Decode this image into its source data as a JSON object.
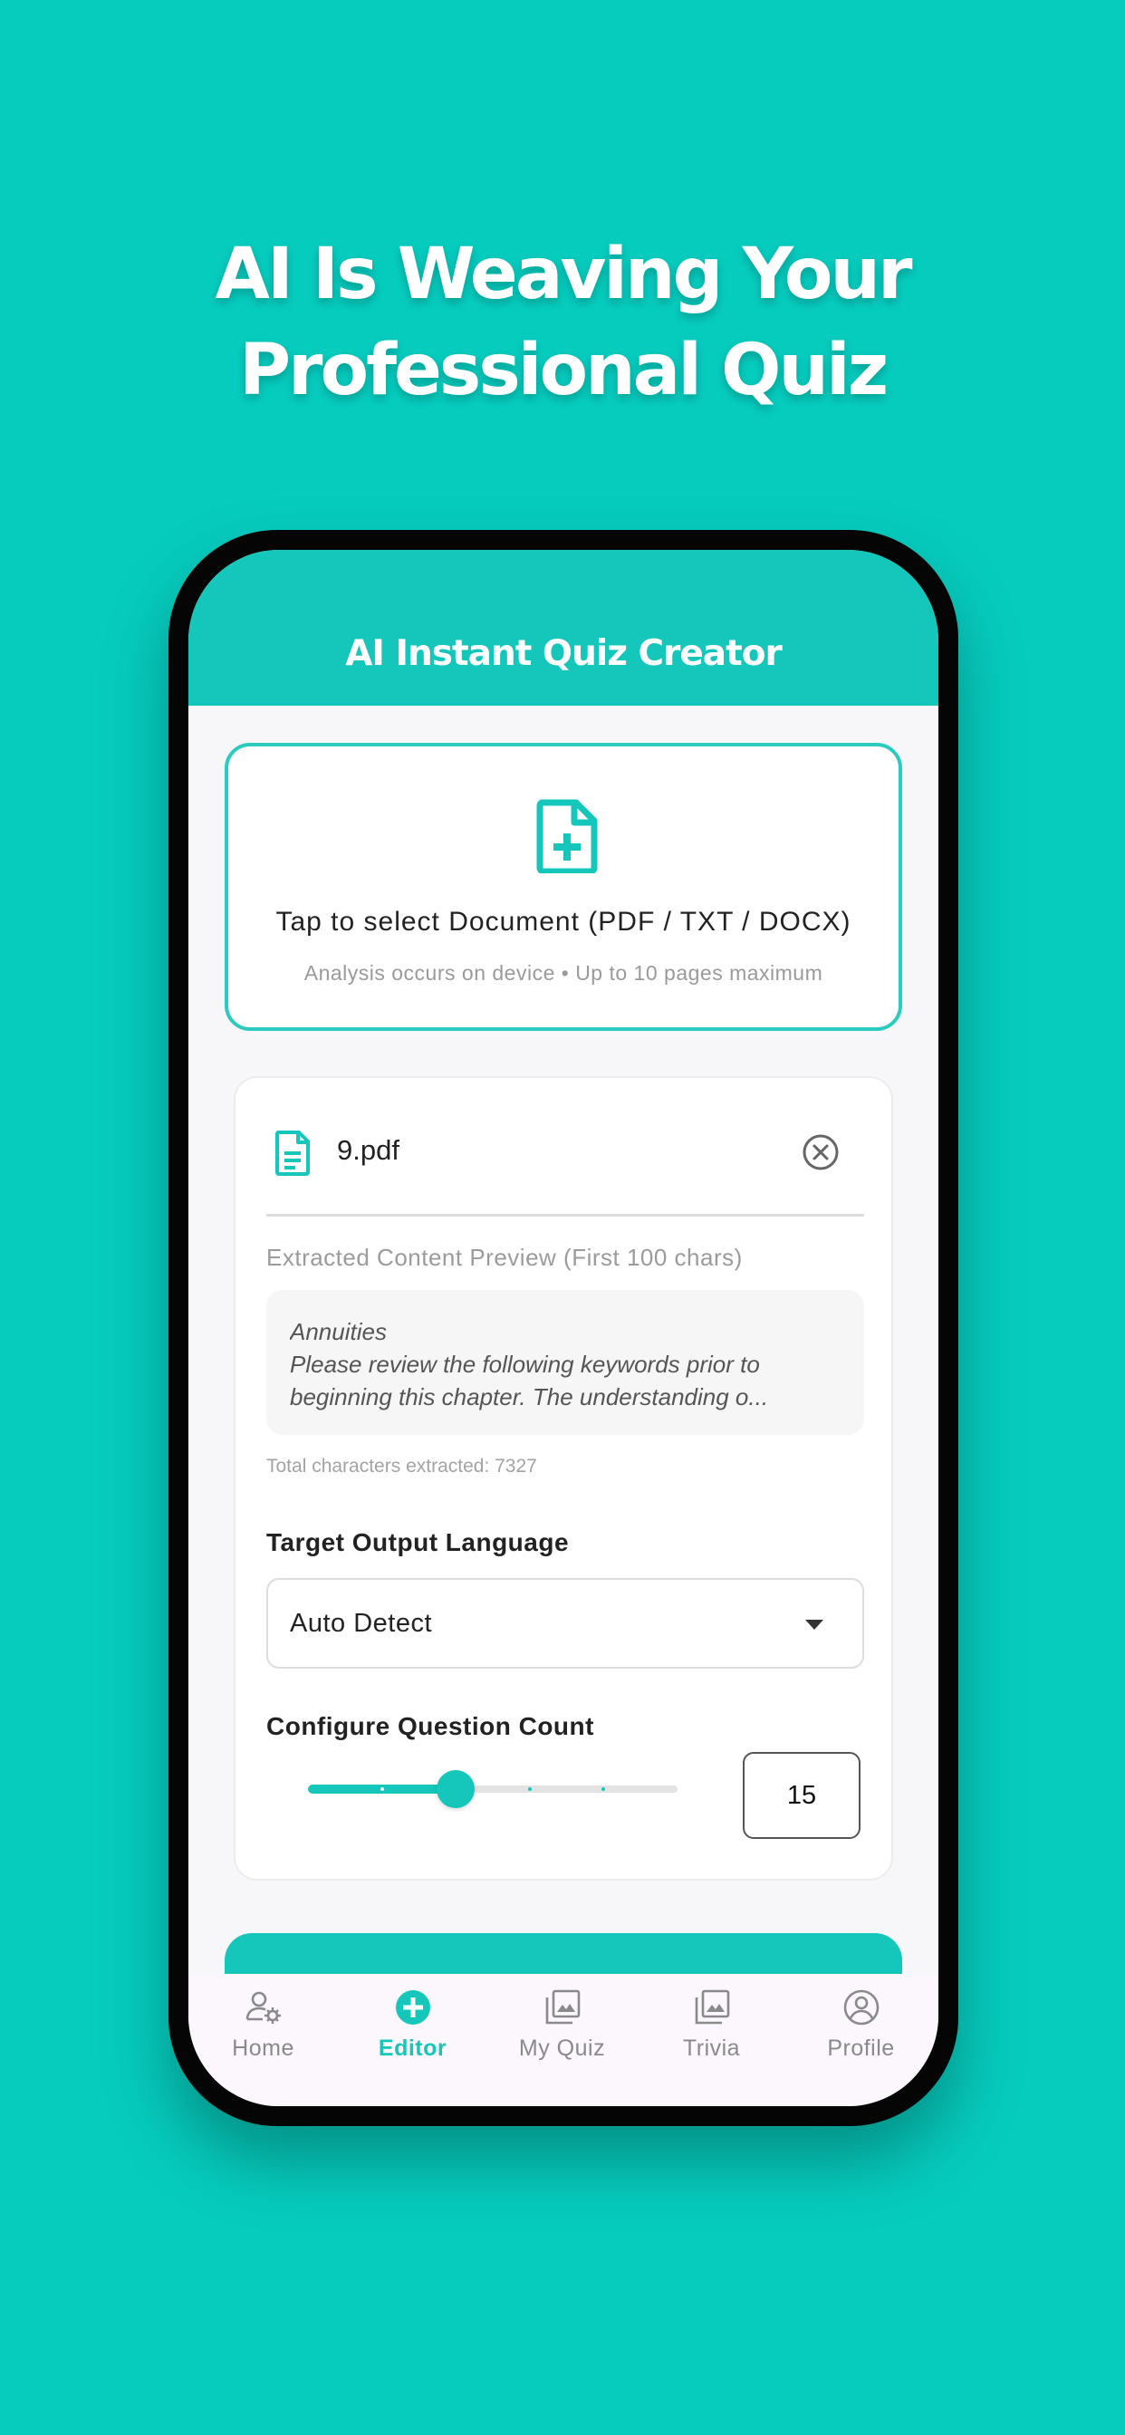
{
  "headline": {
    "line1": "AI Is Weaving Your",
    "line2": "Professional Quiz"
  },
  "app": {
    "title": "AI Instant Quiz Creator",
    "accent_color": "#14C7BA",
    "background_color": "#06CCBE"
  },
  "upload": {
    "icon": "document-add-icon",
    "title": "Tap to select Document (PDF / TXT / DOCX)",
    "subtitle": "Analysis occurs on device • Up to 10 pages maximum"
  },
  "file": {
    "icon": "document-icon",
    "name": "9.pdf",
    "remove_icon": "close-circle-icon",
    "preview_label": "Extracted Content Preview (First 100 chars)",
    "preview_lines": [
      "Annuities",
      "Please review the following keywords prior to",
      "beginning this chapter. The understanding o..."
    ],
    "chars_extracted": "Total characters extracted: 7327"
  },
  "language": {
    "label": "Target Output Language",
    "selected": "Auto Detect",
    "caret_icon": "caret-down-icon"
  },
  "question_count": {
    "label": "Configure Question Count",
    "value": "15",
    "slider_fraction": 0.4,
    "slider_steps": 5
  },
  "bottom_nav": {
    "items": [
      {
        "label": "Home",
        "icon": "user-settings-icon",
        "active": false
      },
      {
        "label": "Editor",
        "icon": "plus-circle-icon",
        "active": true
      },
      {
        "label": "My Quiz",
        "icon": "photo-library-icon",
        "active": false
      },
      {
        "label": "Trivia",
        "icon": "photo-library-icon",
        "active": false
      },
      {
        "label": "Profile",
        "icon": "account-circle-icon",
        "active": false
      }
    ]
  }
}
